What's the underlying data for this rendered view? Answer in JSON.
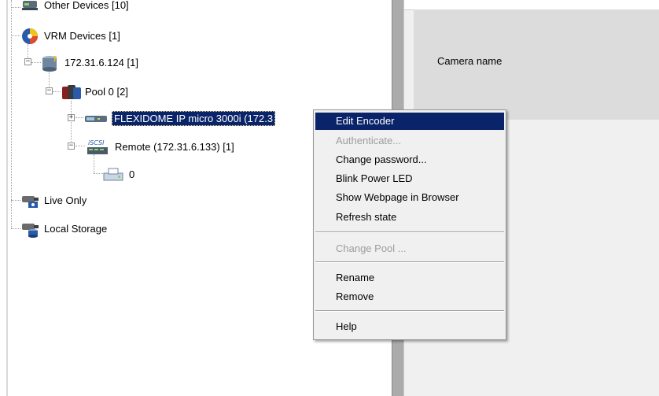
{
  "tree": {
    "nodes": [
      {
        "label": "Other Devices [10]",
        "icon": "other-devices-icon"
      },
      {
        "label": "VRM Devices [1]",
        "icon": "vrm-devices-icon"
      },
      {
        "label": "172.31.6.124 [1]",
        "icon": "vrm-server-icon"
      },
      {
        "label": "Pool 0 [2]",
        "icon": "pool-icon"
      },
      {
        "label": "FLEXIDOME IP micro 3000i (172.3",
        "icon": "encoder-icon"
      },
      {
        "label": "Remote (172.31.6.133) [1]",
        "icon": "iscsi-icon",
        "badge": "iSCSI"
      },
      {
        "label": "0",
        "icon": "lun-icon"
      },
      {
        "label": "Live Only",
        "icon": "live-only-icon"
      },
      {
        "label": "Local Storage",
        "icon": "local-storage-icon"
      }
    ]
  },
  "right_pane": {
    "camera_name_label": "Camera name"
  },
  "context_menu": {
    "items": [
      {
        "label": "Edit Encoder",
        "state": "highlighted"
      },
      {
        "label": "Authenticate...",
        "state": "disabled"
      },
      {
        "label": "Change password...",
        "state": "normal"
      },
      {
        "label": "Blink Power LED",
        "state": "normal"
      },
      {
        "label": "Show Webpage in Browser",
        "state": "normal"
      },
      {
        "label": "Refresh state",
        "state": "normal"
      },
      {
        "label": "Change Pool ...",
        "state": "disabled"
      },
      {
        "label": "Rename",
        "state": "normal"
      },
      {
        "label": "Remove",
        "state": "normal"
      },
      {
        "label": "Help",
        "state": "normal"
      }
    ]
  },
  "colors": {
    "selection": "#0a246a",
    "menu_background": "#f0f0f0",
    "disabled_text": "#9d9d9d"
  }
}
